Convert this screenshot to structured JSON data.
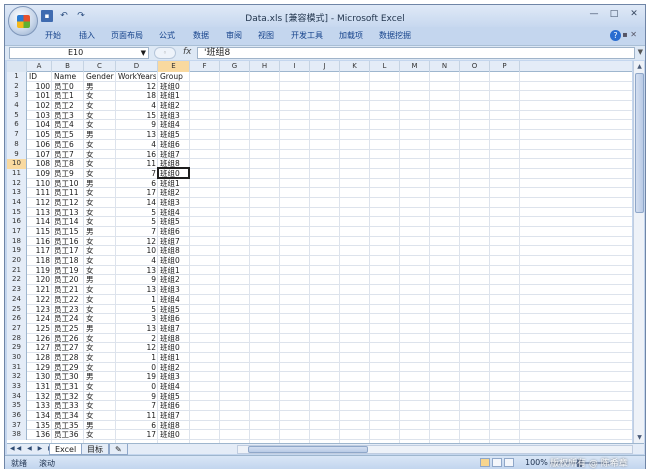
{
  "title": "Data.xls  [兼容模式]  -  Microsoft Excel",
  "quick_access": [
    {
      "icon": "save-icon"
    },
    {
      "icon": "undo-icon",
      "glyph": "↶"
    },
    {
      "icon": "redo-icon",
      "glyph": "↷"
    }
  ],
  "window_controls": {
    "min": "—",
    "max": "□",
    "close": "✕"
  },
  "ribbon_tabs": [
    "开始",
    "插入",
    "页面布局",
    "公式",
    "数据",
    "审阅",
    "视图",
    "开发工具",
    "加载项",
    "数据挖掘"
  ],
  "help": "?",
  "formula_bar": {
    "name_box": "E10",
    "fx_label": "fx",
    "formula": "'班组8"
  },
  "columns": [
    "A",
    "B",
    "C",
    "D",
    "E",
    "F",
    "G",
    "H",
    "I",
    "J",
    "K",
    "L",
    "M",
    "N",
    "O",
    "P"
  ],
  "selected_column": "E",
  "selected_row": "10",
  "rows": [
    {
      "n": "1",
      "a": "ID",
      "b": "Name",
      "c": "Gender",
      "d": "WorkYears",
      "e": "Group"
    },
    {
      "n": "2",
      "a": "100",
      "b": "员工0",
      "c": "男",
      "d": "12",
      "e": "班组0"
    },
    {
      "n": "3",
      "a": "101",
      "b": "员工1",
      "c": "女",
      "d": "18",
      "e": "班组1"
    },
    {
      "n": "4",
      "a": "102",
      "b": "员工2",
      "c": "女",
      "d": "4",
      "e": "班组2"
    },
    {
      "n": "5",
      "a": "103",
      "b": "员工3",
      "c": "女",
      "d": "15",
      "e": "班组3"
    },
    {
      "n": "6",
      "a": "104",
      "b": "员工4",
      "c": "女",
      "d": "9",
      "e": "班组4"
    },
    {
      "n": "7",
      "a": "105",
      "b": "员工5",
      "c": "男",
      "d": "13",
      "e": "班组5"
    },
    {
      "n": "8",
      "a": "106",
      "b": "员工6",
      "c": "女",
      "d": "4",
      "e": "班组6"
    },
    {
      "n": "9",
      "a": "107",
      "b": "员工7",
      "c": "女",
      "d": "16",
      "e": "班组7"
    },
    {
      "n": "10",
      "a": "108",
      "b": "员工8",
      "c": "女",
      "d": "11",
      "e": "班组8"
    },
    {
      "n": "11",
      "a": "109",
      "b": "员工9",
      "c": "女",
      "d": "7",
      "e": "班组0"
    },
    {
      "n": "12",
      "a": "110",
      "b": "员工10",
      "c": "男",
      "d": "6",
      "e": "班组1"
    },
    {
      "n": "13",
      "a": "111",
      "b": "员工11",
      "c": "女",
      "d": "17",
      "e": "班组2"
    },
    {
      "n": "14",
      "a": "112",
      "b": "员工12",
      "c": "女",
      "d": "14",
      "e": "班组3"
    },
    {
      "n": "15",
      "a": "113",
      "b": "员工13",
      "c": "女",
      "d": "5",
      "e": "班组4"
    },
    {
      "n": "16",
      "a": "114",
      "b": "员工14",
      "c": "女",
      "d": "5",
      "e": "班组5"
    },
    {
      "n": "17",
      "a": "115",
      "b": "员工15",
      "c": "男",
      "d": "7",
      "e": "班组6"
    },
    {
      "n": "18",
      "a": "116",
      "b": "员工16",
      "c": "女",
      "d": "12",
      "e": "班组7"
    },
    {
      "n": "19",
      "a": "117",
      "b": "员工17",
      "c": "女",
      "d": "10",
      "e": "班组8"
    },
    {
      "n": "20",
      "a": "118",
      "b": "员工18",
      "c": "女",
      "d": "4",
      "e": "班组0"
    },
    {
      "n": "21",
      "a": "119",
      "b": "员工19",
      "c": "女",
      "d": "13",
      "e": "班组1"
    },
    {
      "n": "22",
      "a": "120",
      "b": "员工20",
      "c": "男",
      "d": "9",
      "e": "班组2"
    },
    {
      "n": "23",
      "a": "121",
      "b": "员工21",
      "c": "女",
      "d": "13",
      "e": "班组3"
    },
    {
      "n": "24",
      "a": "122",
      "b": "员工22",
      "c": "女",
      "d": "1",
      "e": "班组4"
    },
    {
      "n": "25",
      "a": "123",
      "b": "员工23",
      "c": "女",
      "d": "5",
      "e": "班组5"
    },
    {
      "n": "26",
      "a": "124",
      "b": "员工24",
      "c": "女",
      "d": "3",
      "e": "班组6"
    },
    {
      "n": "27",
      "a": "125",
      "b": "员工25",
      "c": "男",
      "d": "13",
      "e": "班组7"
    },
    {
      "n": "28",
      "a": "126",
      "b": "员工26",
      "c": "女",
      "d": "2",
      "e": "班组8"
    },
    {
      "n": "29",
      "a": "127",
      "b": "员工27",
      "c": "女",
      "d": "12",
      "e": "班组0"
    },
    {
      "n": "30",
      "a": "128",
      "b": "员工28",
      "c": "女",
      "d": "1",
      "e": "班组1"
    },
    {
      "n": "31",
      "a": "129",
      "b": "员工29",
      "c": "女",
      "d": "0",
      "e": "班组2"
    },
    {
      "n": "32",
      "a": "130",
      "b": "员工30",
      "c": "男",
      "d": "19",
      "e": "班组3"
    },
    {
      "n": "33",
      "a": "131",
      "b": "员工31",
      "c": "女",
      "d": "0",
      "e": "班组4"
    },
    {
      "n": "34",
      "a": "132",
      "b": "员工32",
      "c": "女",
      "d": "9",
      "e": "班组5"
    },
    {
      "n": "35",
      "a": "133",
      "b": "员工33",
      "c": "女",
      "d": "7",
      "e": "班组6"
    },
    {
      "n": "36",
      "a": "134",
      "b": "员工34",
      "c": "女",
      "d": "11",
      "e": "班组7"
    },
    {
      "n": "37",
      "a": "135",
      "b": "员工35",
      "c": "男",
      "d": "6",
      "e": "班组8"
    },
    {
      "n": "38",
      "a": "136",
      "b": "员工36",
      "c": "女",
      "d": "17",
      "e": "班组0"
    }
  ],
  "sheet_tabs": [
    "Excel",
    "目标"
  ],
  "sheet_nav": "◀◀ ◀ ▶ ▶▶",
  "status": {
    "ready": "就绪",
    "scroll": "滚动",
    "zoom": "100%"
  },
  "watermark": "版权所有 @ 陈希章",
  "colors": {
    "selected_header": "#f9d99f",
    "ribbon_bg": "#c4d6ee",
    "tab_text": "#15428b"
  }
}
